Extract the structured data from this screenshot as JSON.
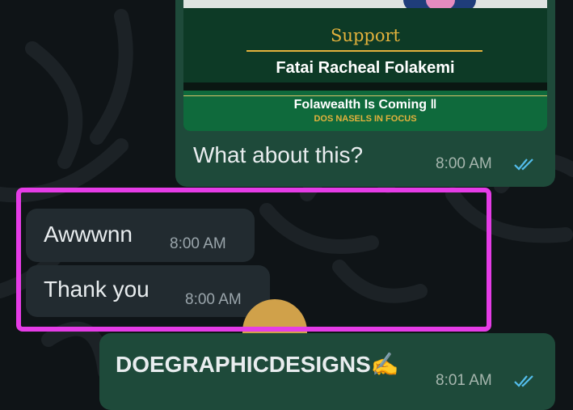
{
  "media_card": {
    "support_label": "Support",
    "person_name": "Fatai Racheal Folakemi",
    "headline": "Folawealth Is Coming ‖",
    "subline": "DOS NASELS IN FOCUS"
  },
  "messages": {
    "out_1": {
      "text": "What about this?",
      "time": "8:00 AM",
      "status_icon": "double-check-read"
    },
    "in_1": {
      "text": "Awwwnn",
      "time": "8:00 AM"
    },
    "in_2": {
      "text": "Thank you",
      "time": "8:00 AM"
    },
    "out_2": {
      "text": "DOEGRAPHICDESIGNS✍️",
      "time": "8:01 AM",
      "status_icon": "double-check-read"
    }
  },
  "colors": {
    "outgoing_bubble": "#1e4a3a",
    "incoming_bubble": "#222b30",
    "highlight": "#e53ce6",
    "read_ticks": "#53bdeb"
  }
}
